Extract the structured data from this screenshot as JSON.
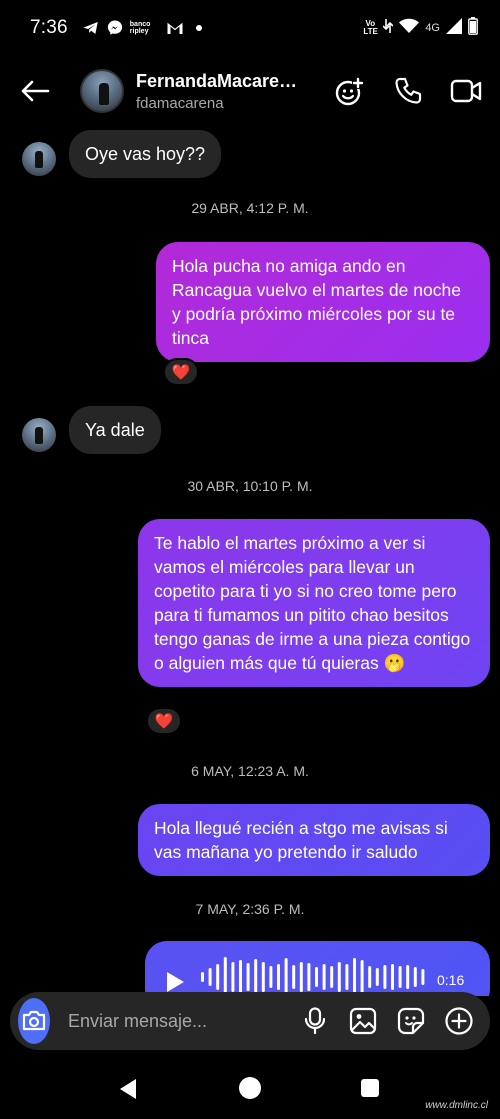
{
  "status_bar": {
    "time": "7:36",
    "bank_badge": "banco ripley",
    "volte": "Vo LTE",
    "network": "4G",
    "icons": [
      "telegram-icon",
      "messenger-icon",
      "gmail-icon",
      "notification-dot-icon",
      "data-arrows-icon",
      "wifi-icon",
      "signal-icon",
      "battery-icon"
    ]
  },
  "header": {
    "title": "FernandaMacare…",
    "username": "fdamacarena",
    "actions": [
      "add-effects-icon",
      "phone-icon",
      "video-call-icon"
    ]
  },
  "messages": [
    {
      "type": "incoming",
      "text": "Oye vas hoy??"
    },
    {
      "type": "timestamp",
      "text": "29 ABR, 4:12 P. M."
    },
    {
      "type": "outgoing",
      "text": "Hola pucha no amiga ando en Rancagua vuelvo el martes de noche y podría próximo miércoles por su te tinca",
      "reaction": "❤️"
    },
    {
      "type": "incoming",
      "text": "Ya dale"
    },
    {
      "type": "timestamp",
      "text": "30 ABR, 10:10 P. M."
    },
    {
      "type": "outgoing",
      "text": "Te hablo el martes próximo a ver si vamos el miércoles para llevar un copetito para ti yo si no creo tome pero para ti fumamos un pitito chao besitos  tengo ganas de irme a una pieza contigo o alguien más que tú quieras 🫢",
      "reaction": "❤️"
    },
    {
      "type": "timestamp",
      "text": "6 MAY, 12:23 A. M."
    },
    {
      "type": "outgoing",
      "text": "Hola llegué recién a stgo me avisas si vas mañana yo pretendo ir saludo"
    },
    {
      "type": "timestamp",
      "text": "7 MAY, 2:36 P. M."
    },
    {
      "type": "voice",
      "duration": "0:16"
    }
  ],
  "composer": {
    "placeholder": "Enviar mensaje..."
  },
  "colors": {
    "bubble_in": "#262626",
    "bubble_out_1": "#a02ee6",
    "bubble_out_2": "#7a3df0",
    "bubble_out_3": "#5a4ef2",
    "camera": "#4f6ef7"
  },
  "watermark": "www.dmlinc.cl"
}
